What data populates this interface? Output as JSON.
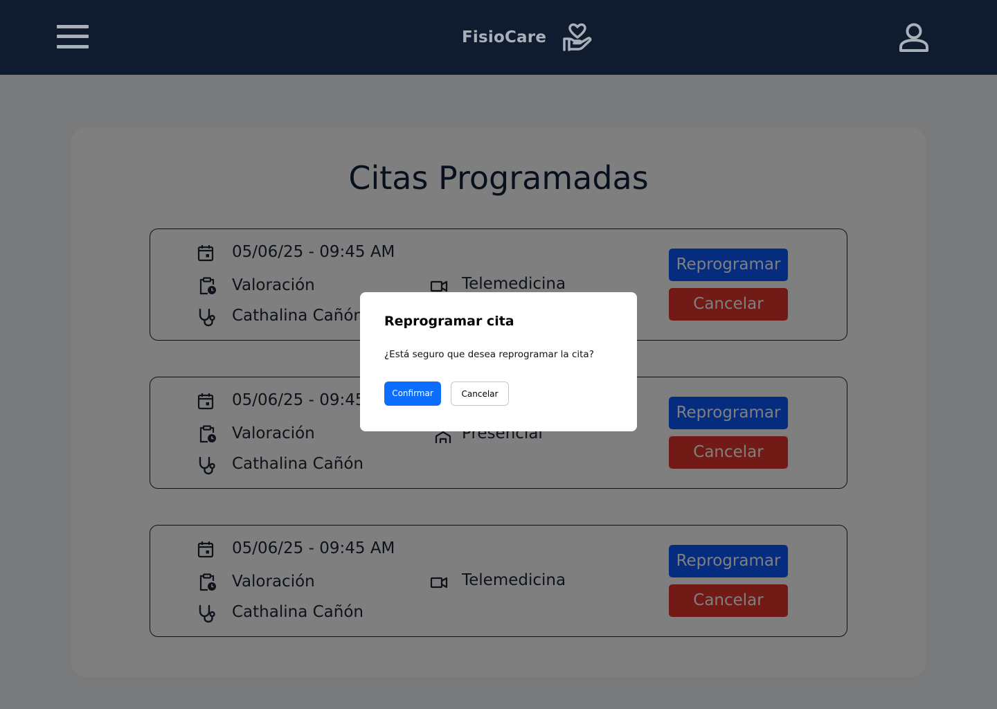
{
  "header": {
    "brand": "FisioCare",
    "icons": {
      "menu": "menu-icon",
      "brand": "hand-heart-icon",
      "user": "user-icon"
    },
    "colors": {
      "bar": "#0f1b2e",
      "foreground": "#a9b0ba"
    }
  },
  "page": {
    "title": "Citas Programadas"
  },
  "appointments": [
    {
      "datetime": "05/06/25 - 09:45 AM",
      "type": "Valoración",
      "modality": "Telemedicina",
      "modality_icon": "video-icon",
      "professional": "Cathalina Cañón",
      "reschedule_label": "Reprogramar",
      "cancel_label": "Cancelar"
    },
    {
      "datetime": "05/06/25 - 09:45 AM",
      "type": "Valoración",
      "modality": "Presencial",
      "modality_icon": "building-icon",
      "professional": "Cathalina Cañón",
      "reschedule_label": "Reprogramar",
      "cancel_label": "Cancelar"
    },
    {
      "datetime": "05/06/25 - 09:45 AM",
      "type": "Valoración",
      "modality": "Telemedicina",
      "modality_icon": "video-icon",
      "professional": "Cathalina Cañón",
      "reschedule_label": "Reprogramar",
      "cancel_label": "Cancelar"
    }
  ],
  "modal": {
    "title": "Reprogramar cita",
    "message": "¿Está seguro que desea reprogramar la cita?",
    "confirm_label": "Confirmar",
    "cancel_label": "Cancelar"
  },
  "colors": {
    "primary": "#0b59ff",
    "danger": "#e2352c",
    "modal_confirm": "#0d6efd",
    "text": "#1a2436"
  }
}
